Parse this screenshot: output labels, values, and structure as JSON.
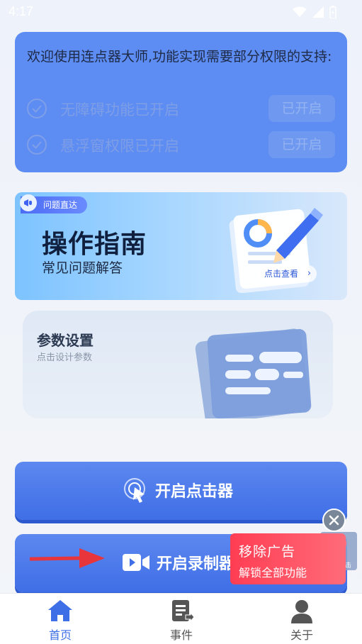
{
  "status_bar": {
    "time": "4:17",
    "icons": [
      "wifi-icon",
      "signal-icon",
      "battery-icon"
    ]
  },
  "permission_card": {
    "title": "欢迎使用连点器大师,功能实现需要部分权限的支持:",
    "rows": [
      {
        "label": "无障碍功能已开启",
        "button": "已开启",
        "icon": "check-circle-icon"
      },
      {
        "label": "悬浮窗权限已开启",
        "button": "已开启",
        "icon": "check-circle-icon"
      }
    ]
  },
  "guide_banner": {
    "tag": "问题直达",
    "title": "操作指南",
    "subtitle": "常见问题解答",
    "view_button": "点击查看",
    "view_chevron": "›"
  },
  "params_card": {
    "title": "参数设置",
    "subtitle": "点击设计参数"
  },
  "buttons": {
    "clicker": "开启点击器",
    "recorder": "开启录制器"
  },
  "ad": {
    "line1": "移除广告",
    "line2": "解锁全部功能",
    "close": "✕"
  },
  "floating_tap": {
    "label": "自动点击"
  },
  "bottom_nav": [
    {
      "label": "首页",
      "icon": "home-icon",
      "active": true
    },
    {
      "label": "事件",
      "icon": "document-icon",
      "active": false
    },
    {
      "label": "关于",
      "icon": "person-icon",
      "active": false
    }
  ],
  "colors": {
    "primary": "#4a78ec",
    "nav_active": "#3e6fe6",
    "nav_inactive": "#555555",
    "ad_red": "#ff4a5d",
    "arrow_red": "#e8353b"
  }
}
